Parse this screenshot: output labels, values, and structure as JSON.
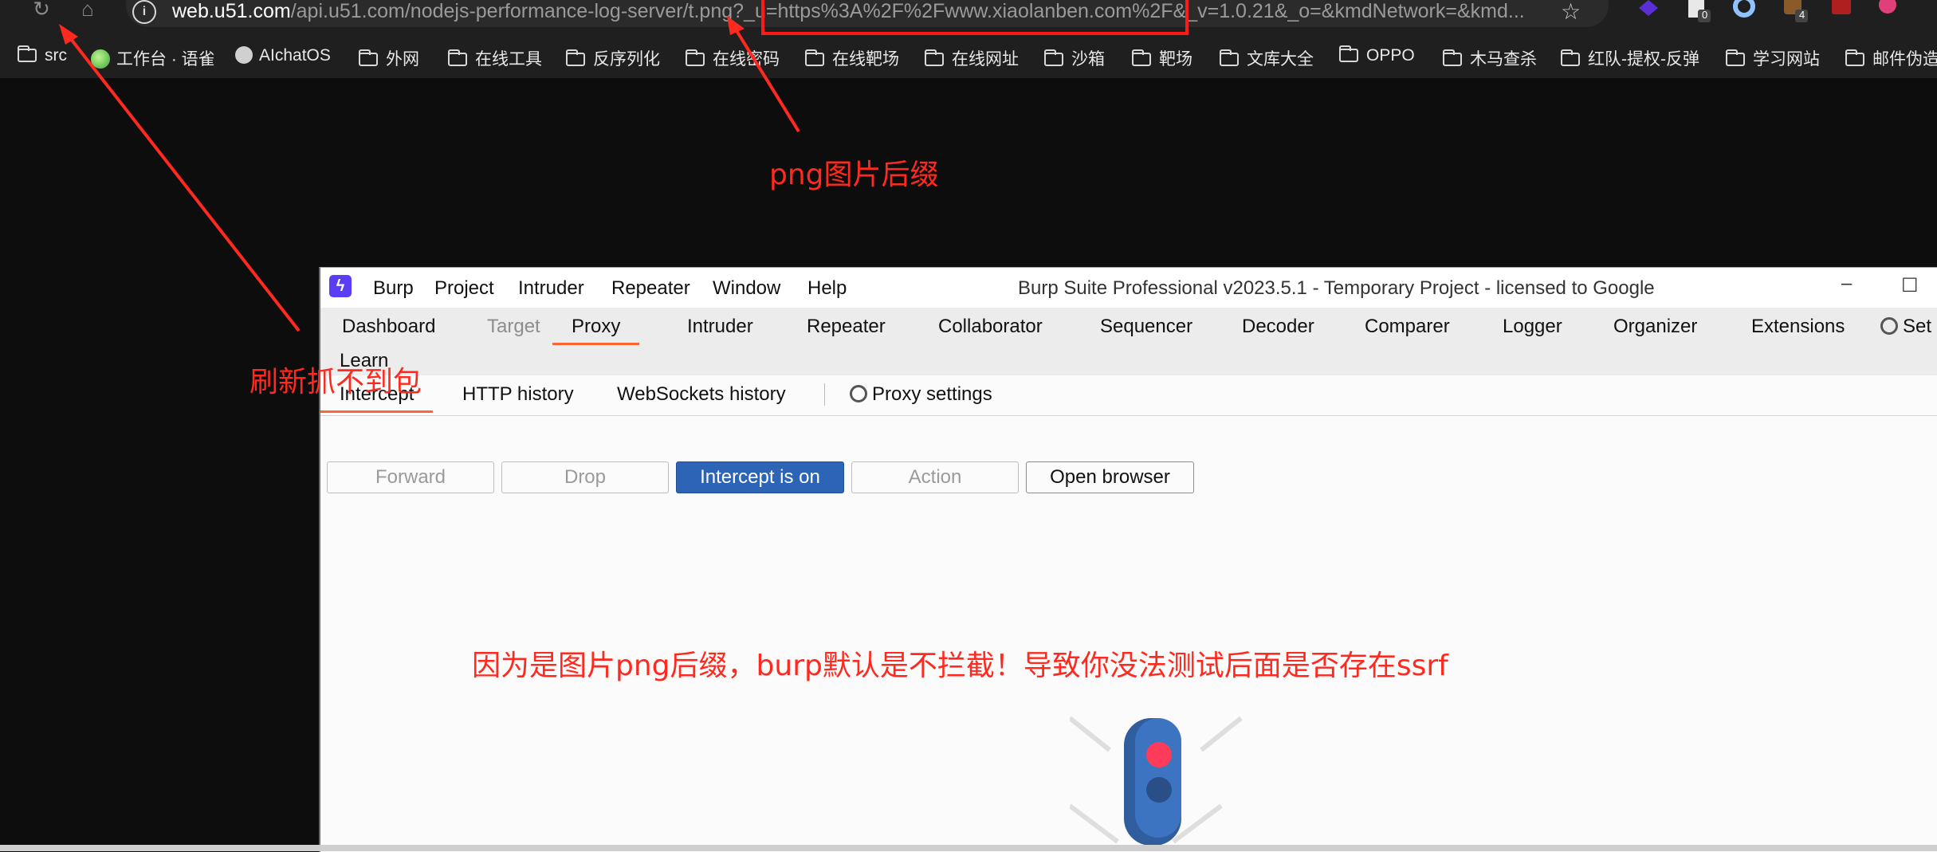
{
  "browser": {
    "url_host": "web.u51.com",
    "url_rest": "/api.u51.com/nodejs-performance-log-server/t.png?_u=https%3A%2F%2Fwww.xiaolanben.com%2F&_v=1.0.21&_o=&kmdNetwork=&kmd...",
    "ext_badges": [
      "0",
      "4"
    ],
    "bookmarks": [
      "src",
      "工作台 · 语雀",
      "AIchatOS",
      "外网",
      "在线工具",
      "反序列化",
      "在线密码",
      "在线靶场",
      "在线网址",
      "沙箱",
      "靶场",
      "文库大全",
      "OPPO",
      "木马查杀",
      "红队-提权-反弹",
      "学习网站",
      "邮件伪造"
    ]
  },
  "annotations": {
    "png_suffix": "png图片后缀",
    "refresh_no_capture": "刷新抓不到包",
    "explanation": "因为是图片png后缀，burp默认是不拦截！导致你没法测试后面是否存在ssrf"
  },
  "burp": {
    "menu": [
      "Burp",
      "Project",
      "Intruder",
      "Repeater",
      "Window",
      "Help"
    ],
    "window_title": "Burp Suite Professional v2023.5.1 - Temporary Project - licensed to Google",
    "main_tabs": [
      "Dashboard",
      "Target",
      "Proxy",
      "Intruder",
      "Repeater",
      "Collaborator",
      "Sequencer",
      "Decoder",
      "Comparer",
      "Logger",
      "Organizer",
      "Extensions",
      "Set",
      "Learn"
    ],
    "sub_tabs": [
      "Intercept",
      "HTTP history",
      "WebSockets history"
    ],
    "proxy_settings": "Proxy settings",
    "buttons": {
      "forward": "Forward",
      "drop": "Drop",
      "intercept": "Intercept is on",
      "action": "Action",
      "open_browser": "Open browser"
    }
  },
  "colors": {
    "annotation_red": "#ff2a1f",
    "burp_accent": "#ff6633",
    "intercept_blue": "#2d64b5"
  }
}
